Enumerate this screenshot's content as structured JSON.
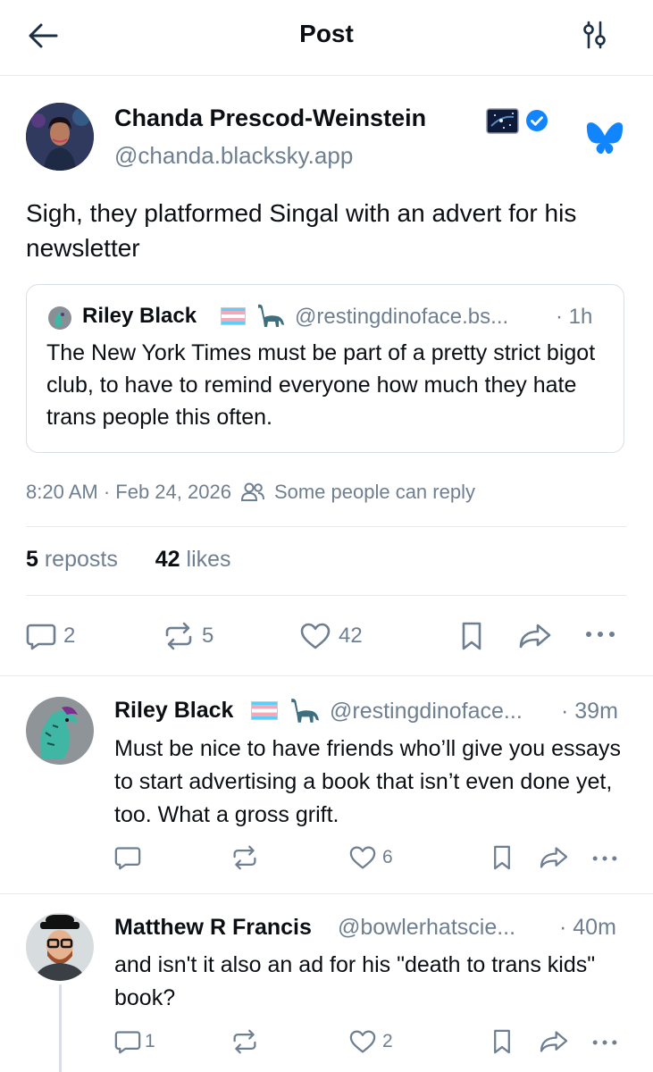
{
  "header": {
    "title": "Post"
  },
  "post": {
    "author_name": "Chanda Prescod-Weinstein",
    "author_handle": "@chanda.blacksky.app",
    "text": "Sigh, they platformed Singal with an advert for his newsletter",
    "quote": {
      "author_name": "Riley Black",
      "author_handle": "@restingdinoface.bs...",
      "time": "· 1h",
      "text": "The New York Times must be part of a pretty strict bigot club, to have to remind everyone how much they hate trans people this often."
    },
    "timestamp": "8:20 AM · Feb 24, 2026",
    "reply_setting": "Some people can reply",
    "reposts_count": "5",
    "reposts_label": "reposts",
    "likes_count": "42",
    "likes_label": "likes",
    "actions": {
      "replies": "2",
      "reposts": "5",
      "likes": "42"
    }
  },
  "replies": [
    {
      "author_name": "Riley Black",
      "author_handle": "@restingdinoface...",
      "time": "· 39m",
      "text": "Must be nice to have friends who’ll give you essays to start advertising a book that isn’t even done yet, too. What a gross grift.",
      "replies": "",
      "reposts": "",
      "likes": "6"
    },
    {
      "author_name": "Matthew R Francis",
      "author_handle": "@bowlerhatscie...",
      "time": "· 40m",
      "text": "and isn't it also an ad for his \"death to trans kids\" book?",
      "replies": "1",
      "reposts": "",
      "likes": "2"
    }
  ],
  "colors": {
    "accent": "#1185fe",
    "muted": "#6f7f92",
    "divider": "#e6eaef",
    "verified": "#1185fe"
  }
}
